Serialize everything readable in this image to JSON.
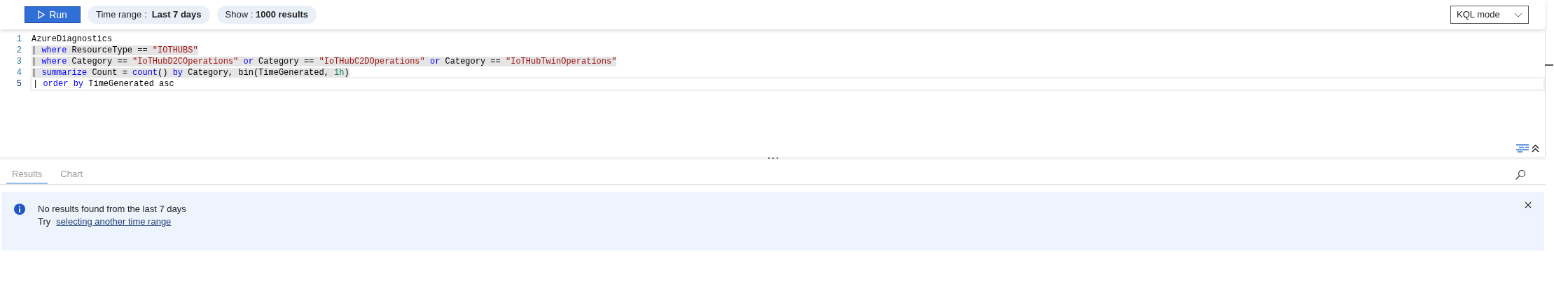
{
  "toolbar": {
    "run_button": "Run",
    "time_range": {
      "label": "Time range :",
      "value": "Last 7 days"
    },
    "show": {
      "label": "Show :",
      "value": "1000 results"
    },
    "mode_select": {
      "value": "KQL mode"
    }
  },
  "editor": {
    "lines": [
      {
        "number": "1",
        "highlighted": false,
        "current": false,
        "tokens": [
          {
            "kind": "plain",
            "text": "AzureDiagnostics"
          }
        ]
      },
      {
        "number": "2",
        "highlighted": true,
        "current": false,
        "tokens": [
          {
            "kind": "plain",
            "text": "| "
          },
          {
            "kind": "keyword",
            "text": "where"
          },
          {
            "kind": "plain",
            "text": " ResourceType == "
          },
          {
            "kind": "string",
            "text": "\"IOTHUBS\""
          }
        ]
      },
      {
        "number": "3",
        "highlighted": true,
        "current": false,
        "tokens": [
          {
            "kind": "plain",
            "text": "| "
          },
          {
            "kind": "keyword",
            "text": "where"
          },
          {
            "kind": "plain",
            "text": " Category == "
          },
          {
            "kind": "string",
            "text": "\"IoTHubD2COperations\" "
          },
          {
            "kind": "keyword",
            "text": "or"
          },
          {
            "kind": "plain",
            "text": " Category == "
          },
          {
            "kind": "string",
            "text": "\"IoTHubC2DOperations\" "
          },
          {
            "kind": "keyword",
            "text": "or"
          },
          {
            "kind": "plain",
            "text": " Category == "
          },
          {
            "kind": "string",
            "text": "\"IoTHubTwinOperations\""
          }
        ]
      },
      {
        "number": "4",
        "highlighted": true,
        "current": false,
        "tokens": [
          {
            "kind": "plain",
            "text": "| "
          },
          {
            "kind": "keyword",
            "text": "summarize"
          },
          {
            "kind": "plain",
            "text": " Count = "
          },
          {
            "kind": "keyword",
            "text": "count"
          },
          {
            "kind": "plain",
            "text": "() "
          },
          {
            "kind": "keyword",
            "text": "by"
          },
          {
            "kind": "plain",
            "text": " Category, bin(TimeGenerated, "
          },
          {
            "kind": "number",
            "text": "1h"
          },
          {
            "kind": "plain",
            "text": ")"
          }
        ]
      },
      {
        "number": "5",
        "highlighted": false,
        "current": true,
        "tokens": [
          {
            "kind": "plain",
            "text": "| "
          },
          {
            "kind": "keyword",
            "text": "order "
          },
          {
            "kind": "keyword",
            "text": "by"
          },
          {
            "kind": "plain",
            "text": " TimeGenerated asc"
          }
        ]
      }
    ]
  },
  "tabs": [
    {
      "label": "Results",
      "selected": true
    },
    {
      "label": "Chart",
      "selected": false
    }
  ],
  "message": {
    "title": "No results found from the last 7 days",
    "prefix": "Try",
    "link": "selecting another time range"
  }
}
